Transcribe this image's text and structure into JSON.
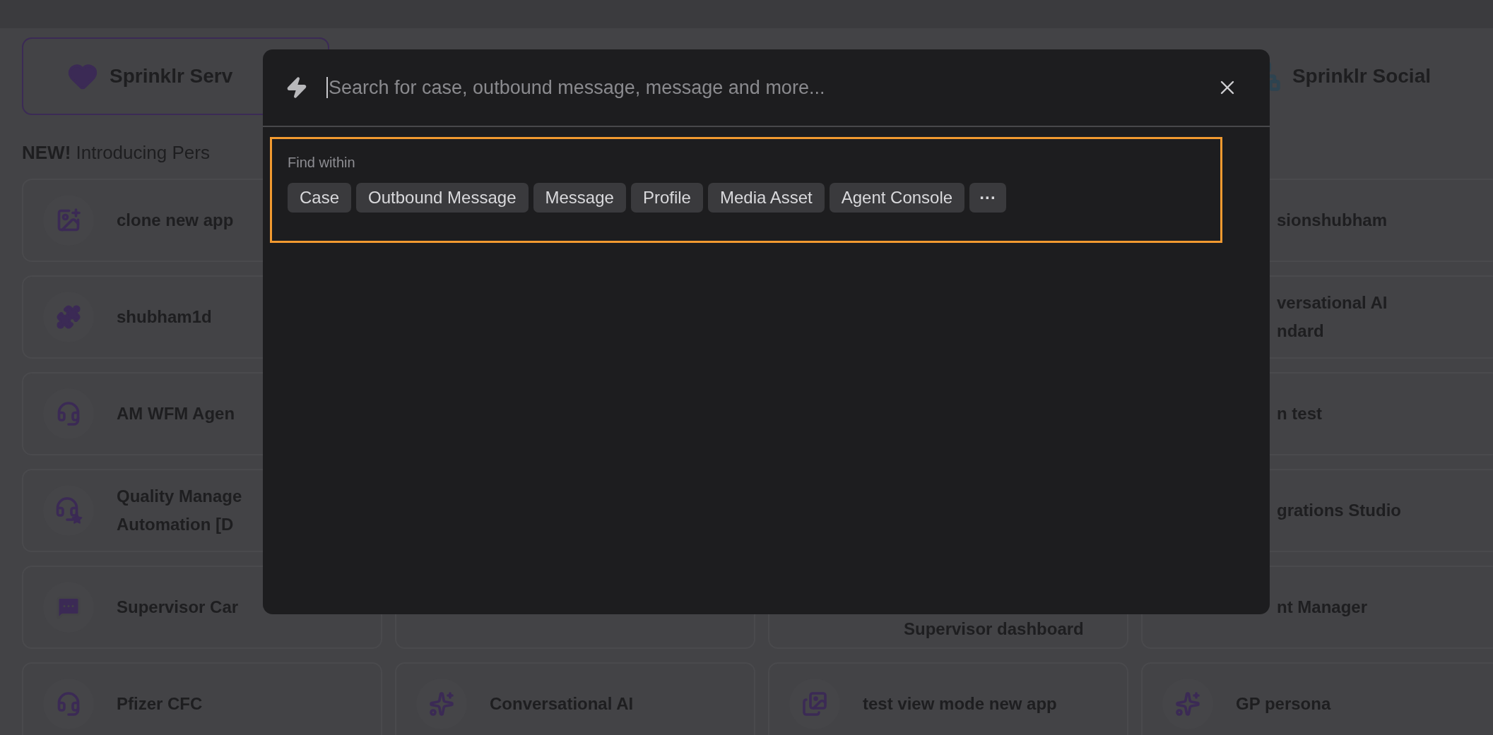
{
  "top_cards": [
    {
      "label": "Sprinklr Serv",
      "selected": true
    },
    {
      "label": "Sprinklr Social",
      "selected": false
    }
  ],
  "announcement": {
    "badge": "NEW!",
    "text": "Introducing Pers"
  },
  "columns": [
    {
      "cards": [
        {
          "lines": [
            "clone new app"
          ]
        },
        {
          "lines": [
            "shubham1d"
          ]
        },
        {
          "lines": [
            "AM WFM Agen"
          ]
        },
        {
          "lines": [
            "Quality Manage",
            "Automation [D"
          ]
        },
        {
          "lines": [
            "Supervisor Car"
          ]
        },
        {
          "lines": [
            "Pfizer CFC"
          ]
        }
      ]
    },
    {
      "cards": [
        {
          "lines": [
            "Conversational AI"
          ]
        }
      ]
    },
    {
      "cards": [
        {
          "lines": [
            "Supervisor dashboard"
          ]
        },
        {
          "lines": [
            "test view mode new app"
          ]
        }
      ]
    },
    {
      "cards": [
        {
          "lines": [
            "sionshubham"
          ]
        },
        {
          "lines": [
            "versational AI",
            "ndard"
          ]
        },
        {
          "lines": [
            "n test"
          ]
        },
        {
          "lines": [
            "grations Studio"
          ]
        },
        {
          "lines": [
            "nt Manager"
          ]
        },
        {
          "lines": [
            "GP persona"
          ]
        }
      ]
    }
  ],
  "search_dialog": {
    "placeholder": "Search for case, outbound message, message and more...",
    "find_within": {
      "label": "Find within",
      "chips": [
        "Case",
        "Outbound Message",
        "Message",
        "Profile",
        "Media Asset",
        "Agent Console"
      ],
      "more": "···"
    }
  }
}
